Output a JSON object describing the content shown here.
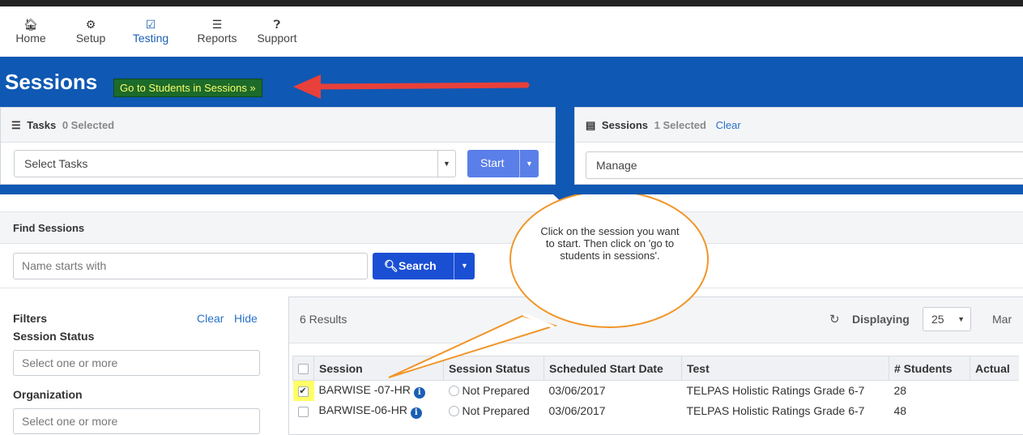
{
  "nav": [
    {
      "label": "Home",
      "icon": "home-icon"
    },
    {
      "label": "Setup",
      "icon": "gear-icon"
    },
    {
      "label": "Testing",
      "icon": "checkbox-icon"
    },
    {
      "label": "Reports",
      "icon": "reports-icon"
    },
    {
      "label": "Support",
      "icon": "question-icon"
    }
  ],
  "page": {
    "title": "Sessions",
    "go_students_label": "Go to Students in Sessions »"
  },
  "tasks": {
    "title": "Tasks",
    "selected": "0 Selected",
    "select_value": "Select Tasks",
    "start_label": "Start"
  },
  "sessions_panel": {
    "title": "Sessions",
    "selected": "1 Selected",
    "clear_label": "Clear",
    "select_value": "Manage"
  },
  "find": {
    "title": "Find Sessions",
    "placeholder": "Name starts with",
    "search_label": "Search"
  },
  "filters": {
    "title": "Filters",
    "clear_label": "Clear",
    "hide_label": "Hide",
    "session_status_label": "Session Status",
    "session_status_placeholder": "Select one or more",
    "organization_label": "Organization",
    "organization_placeholder": "Select one or more"
  },
  "results": {
    "count": "6 Results",
    "displaying_label": "Displaying",
    "per_page": "25",
    "more_label": "Mar",
    "columns": [
      "Session",
      "Session Status",
      "Scheduled Start Date",
      "Test",
      "# Students",
      "Actual"
    ],
    "rows": [
      {
        "checked": true,
        "session": "BARWISE -07-HR",
        "status": "Not Prepared",
        "date": "03/06/2017",
        "test": "TELPAS Holistic Ratings Grade 6-7",
        "students": "28"
      },
      {
        "checked": false,
        "session": "BARWISE-06-HR",
        "status": "Not Prepared",
        "date": "03/06/2017",
        "test": "TELPAS Holistic Ratings Grade 6-7",
        "students": "48"
      }
    ]
  },
  "callout": {
    "text": "Click on the session you want to start. Then click on 'go to students in sessions'."
  },
  "colors": {
    "brand_blue": "#0f58b3",
    "callout_orange": "#f0962a",
    "arrow_red": "#e8403a",
    "highlight_yellow": "#ffff66"
  }
}
